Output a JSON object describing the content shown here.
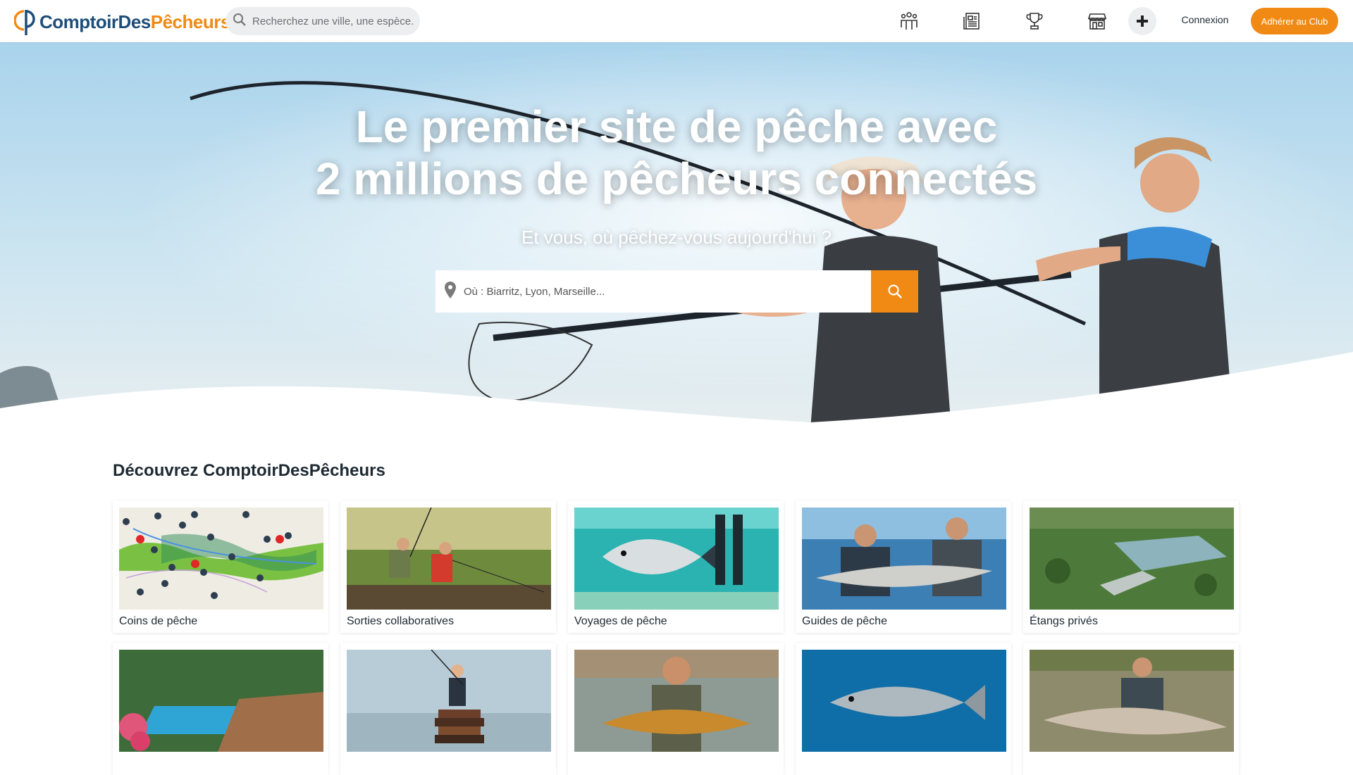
{
  "brand": {
    "part1": "ComptoirDes",
    "part2": "Pêcheurs",
    "accent": "#f18a14",
    "primary": "#1e4e79"
  },
  "header": {
    "search_placeholder": "Recherchez une ville, une espèce..",
    "nav_icons": [
      "community-icon",
      "news-icon",
      "trophy-icon",
      "shop-icon",
      "plus-icon"
    ],
    "login_label": "Connexion",
    "join_label": "Adhérer au Club"
  },
  "hero": {
    "title_line1": "Le premier site de pêche avec",
    "title_line2": "2 millions de pêcheurs connectés",
    "subtitle": "Et vous, où pêchez-vous aujourd'hui ?",
    "where_placeholder": "Où : Biarritz, Lyon, Marseille..."
  },
  "discover": {
    "title": "Découvrez ComptoirDesPêcheurs",
    "cards": [
      {
        "label": "Coins de pêche"
      },
      {
        "label": "Sorties collaboratives"
      },
      {
        "label": "Voyages de pêche"
      },
      {
        "label": "Guides de pêche"
      },
      {
        "label": "Étangs privés"
      },
      {
        "label": ""
      },
      {
        "label": ""
      },
      {
        "label": ""
      },
      {
        "label": ""
      },
      {
        "label": ""
      }
    ]
  }
}
